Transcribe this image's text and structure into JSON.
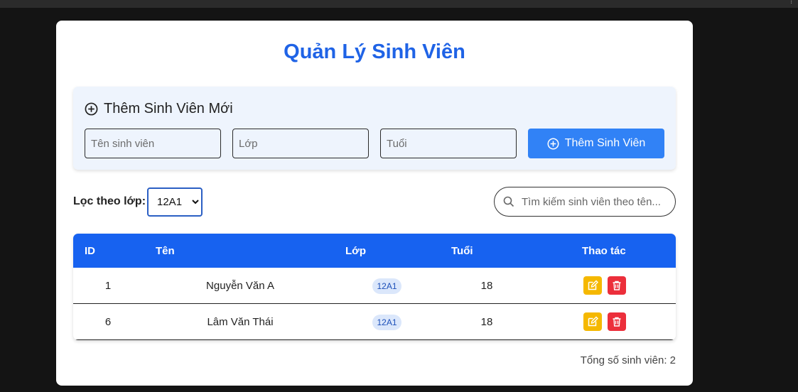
{
  "page": {
    "title": "Quản Lý Sinh Viên"
  },
  "add_form": {
    "heading": "Thêm Sinh Viên Mới",
    "name_placeholder": "Tên sinh viên",
    "class_placeholder": "Lớp",
    "age_placeholder": "Tuổi",
    "submit_label": "Thêm Sinh Viên",
    "icon": "plus-circle-icon"
  },
  "filter": {
    "label": "Lọc theo lớp:",
    "selected": "12A1"
  },
  "search": {
    "placeholder": "Tìm kiếm sinh viên theo tên...",
    "icon": "search-icon"
  },
  "table": {
    "headers": [
      "ID",
      "Tên",
      "Lớp",
      "Tuổi",
      "Thao tác"
    ],
    "rows": [
      {
        "id": "1",
        "name": "Nguyễn Văn A",
        "class": "12A1",
        "age": "18"
      },
      {
        "id": "6",
        "name": "Lâm Văn Thái",
        "class": "12A1",
        "age": "18"
      }
    ]
  },
  "footer": {
    "total": "Tổng số sinh viên: 2"
  },
  "colors": {
    "primary": "#1762f0",
    "title": "#1f63e6",
    "edit": "#f5b800",
    "delete": "#ec2f3b"
  }
}
